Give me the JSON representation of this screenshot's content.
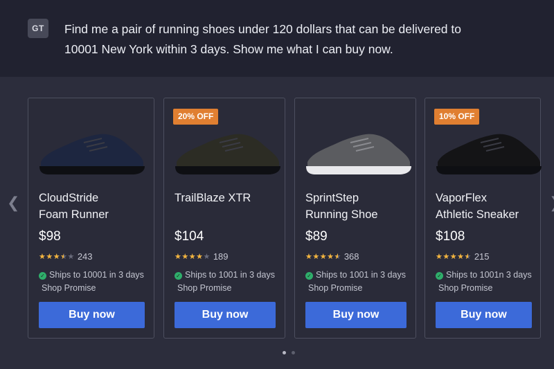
{
  "prompt": {
    "avatar_initials": "GT",
    "line1": "Find me a pair of running shoes under 120 dollars that can be delivered to",
    "line2": "10001 New York within 3 days. Show me what I can buy now."
  },
  "products": [
    {
      "name_line1": "CloudStride",
      "name_line2": "Foam Runner",
      "price": "$98",
      "rating_stars": 3.5,
      "review_count": "243",
      "shipping": "Ships to 10001 in 3 days",
      "promise": "Shop Promise",
      "buy_label": "Buy now",
      "shoe_color": "#1d2640"
    },
    {
      "badge": "20% OFF",
      "name_line1": "TrailBlaze XTR",
      "name_line2": "",
      "price": "$104",
      "rating_stars": 4,
      "review_count": "189",
      "shipping": "Ships to 1001 in 3 days",
      "promise": "Shop Promise",
      "buy_label": "Buy now",
      "shoe_color": "#2c2c24"
    },
    {
      "name_line1": "SprintStep",
      "name_line2": "Running Shoe",
      "price": "$89",
      "rating_stars": 4.5,
      "review_count": "368",
      "shipping": "Ships to 1001 in 3 days",
      "promise": "Shop Promise",
      "buy_label": "Buy now",
      "shoe_color": "#5b5c60"
    },
    {
      "badge": "10% OFF",
      "name_line1": "VaporFlex",
      "name_line2": "Athletic Sneaker",
      "price": "$108",
      "rating_stars": 4.5,
      "review_count": "215",
      "shipping": "Ships to 1001n 3 days",
      "promise": "Shop Promise",
      "buy_label": "Buy now",
      "shoe_color": "#141416"
    }
  ],
  "carousel": {
    "prev_icon": "chevron-left-icon",
    "next_icon": "chevron-right-icon",
    "page_count": 2,
    "active_page": 1
  }
}
